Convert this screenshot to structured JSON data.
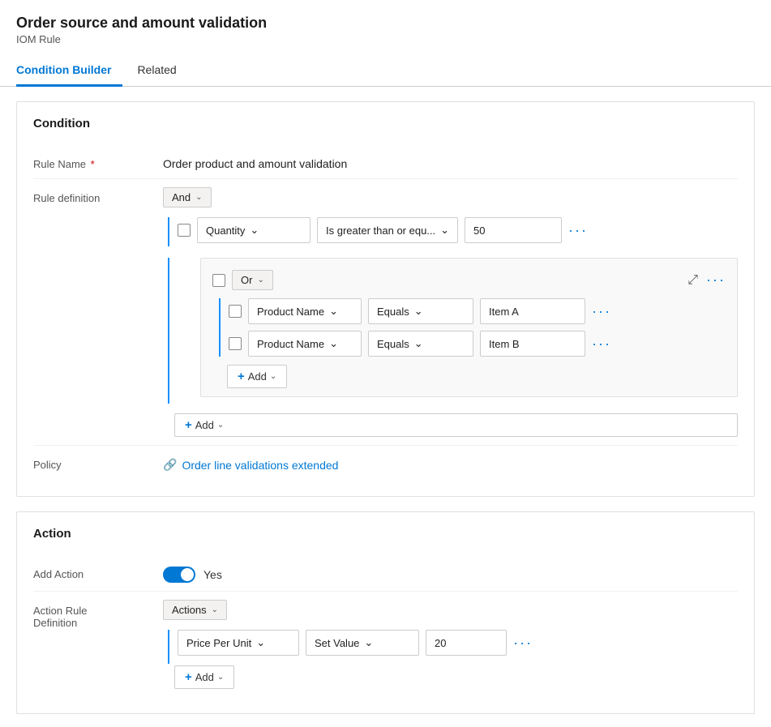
{
  "header": {
    "title": "Order source and amount validation",
    "subtitle": "IOM Rule"
  },
  "tabs": [
    {
      "id": "condition-builder",
      "label": "Condition Builder",
      "active": true
    },
    {
      "id": "related",
      "label": "Related",
      "active": false
    }
  ],
  "condition_section": {
    "title": "Condition",
    "rule_name_label": "Rule Name",
    "rule_name_required": "*",
    "rule_name_value": "Order product and amount validation",
    "rule_definition_label": "Rule definition",
    "policy_label": "Policy",
    "policy_link_text": "Order line validations extended",
    "and_operator": "And",
    "or_operator": "Or",
    "quantity_field": "Quantity",
    "quantity_operator": "Is greater than or equ...",
    "quantity_value": "50",
    "product_name_field": "Product Name",
    "equals_operator": "Equals",
    "item_a_value": "Item A",
    "item_b_value": "Item B",
    "add_label": "Add"
  },
  "action_section": {
    "title": "Action",
    "add_action_label": "Add Action",
    "toggle_value": "Yes",
    "action_rule_def_label": "Action Rule\nDefinition",
    "actions_operator": "Actions",
    "price_per_unit_field": "Price Per Unit",
    "set_value_operator": "Set Value",
    "action_value": "20",
    "add_label": "Add"
  },
  "icons": {
    "more": "···",
    "compress": "⤢",
    "plus": "+",
    "chevron_down": "∨",
    "policy_icon": "🔗"
  }
}
